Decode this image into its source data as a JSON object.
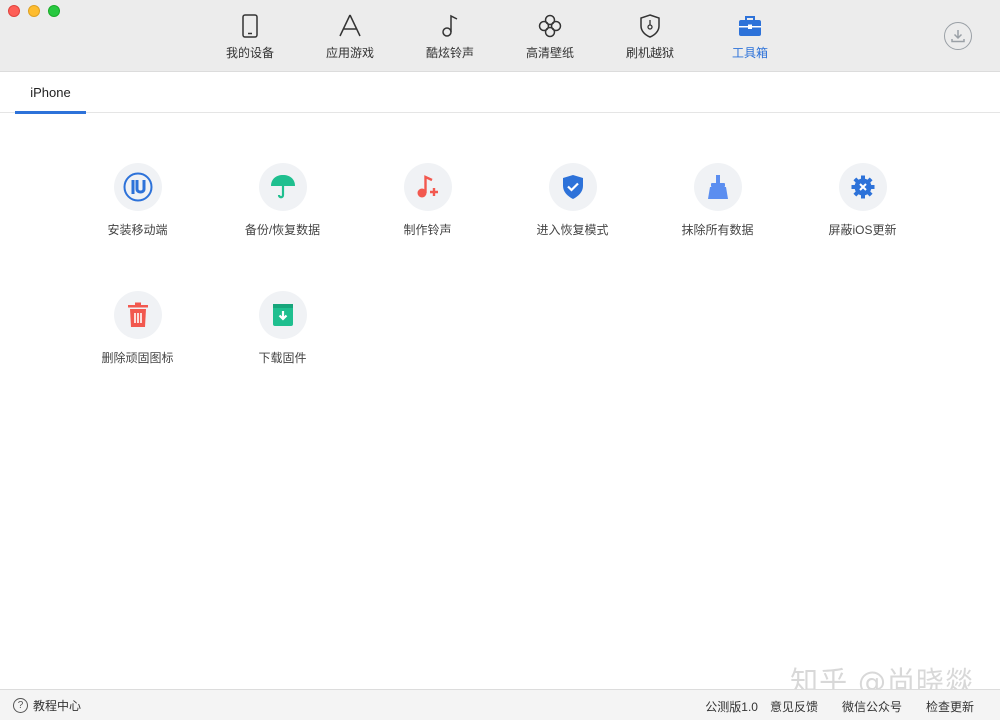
{
  "colors": {
    "accent": "#2d72d9",
    "toolbar_bg": "#ececec"
  },
  "nav": [
    {
      "label": "我的设备",
      "icon": "tablet-icon"
    },
    {
      "label": "应用游戏",
      "icon": "app-store-icon"
    },
    {
      "label": "酷炫铃声",
      "icon": "music-note-icon"
    },
    {
      "label": "高清壁纸",
      "icon": "flower-icon"
    },
    {
      "label": "刷机越狱",
      "icon": "shield-key-icon"
    },
    {
      "label": "工具箱",
      "icon": "toolbox-icon",
      "active": true
    }
  ],
  "subtabs": {
    "active": "iPhone"
  },
  "tools": [
    {
      "label": "安装移动端",
      "icon": "iu-logo-icon"
    },
    {
      "label": "备份/恢复数据",
      "icon": "umbrella-icon"
    },
    {
      "label": "制作铃声",
      "icon": "music-plus-icon"
    },
    {
      "label": "进入恢复模式",
      "icon": "shield-check-icon"
    },
    {
      "label": "抹除所有数据",
      "icon": "broom-icon"
    },
    {
      "label": "屏蔽iOS更新",
      "icon": "gear-x-icon"
    },
    {
      "label": "删除顽固图标",
      "icon": "trash-icon"
    },
    {
      "label": "下载固件",
      "icon": "download-box-icon"
    }
  ],
  "watermark": "知乎 @尚晓燚",
  "statusbar": {
    "help": "教程中心",
    "version": "公测版1.0",
    "feedback": "意见反馈",
    "wechat": "微信公众号",
    "update": "检查更新"
  }
}
